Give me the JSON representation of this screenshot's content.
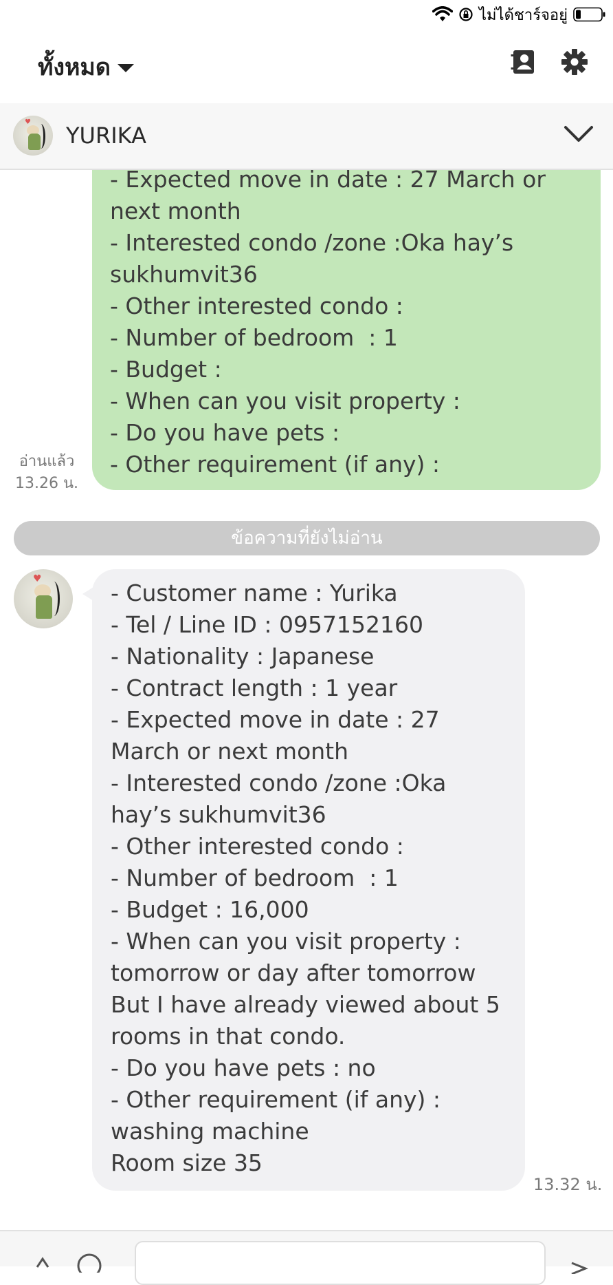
{
  "status": {
    "carrier_text": "ไม่ได้ชาร์จอยู่"
  },
  "topbar": {
    "filter_label": "ทั้งหมด"
  },
  "chat": {
    "name": "YURIKA"
  },
  "outgoing": {
    "lines": [
      "- Expected move in date : 27 March or",
      "next month",
      "- Interested condo /zone :Oka hay’s",
      "sukhumvit36",
      "- Other interested condo :",
      "- Number of bedroom  : 1",
      "- Budget :",
      "- When can you visit property :",
      "- Do you have pets :",
      "- Other requirement (if any) :"
    ],
    "read_label": "อ่านแล้ว",
    "time": "13.26 น."
  },
  "divider": {
    "label": "ข้อความที่ยังไม่อ่าน"
  },
  "incoming": {
    "lines": [
      "- Customer name : Yurika",
      "- Tel / Line ID : 0957152160",
      "- Nationality : Japanese",
      "- Contract length : 1 year",
      "- Expected move in date : 27",
      "March or next month",
      "- Interested condo /zone :Oka",
      "hay’s sukhumvit36",
      "- Other interested condo :",
      "- Number of bedroom  : 1",
      "- Budget : 16,000",
      "- When can you visit property :",
      "tomorrow or day after tomorrow",
      "But I have already viewed about 5",
      "rooms in that condo.",
      "- Do you have pets : no",
      "- Other requirement (if any) :",
      "washing machine",
      "Room size 35"
    ],
    "time": "13.32 น."
  },
  "colors": {
    "outgoing_bubble": "#c3e7b9",
    "incoming_bubble": "#f1f1f3",
    "divider": "#cbcbcb"
  }
}
